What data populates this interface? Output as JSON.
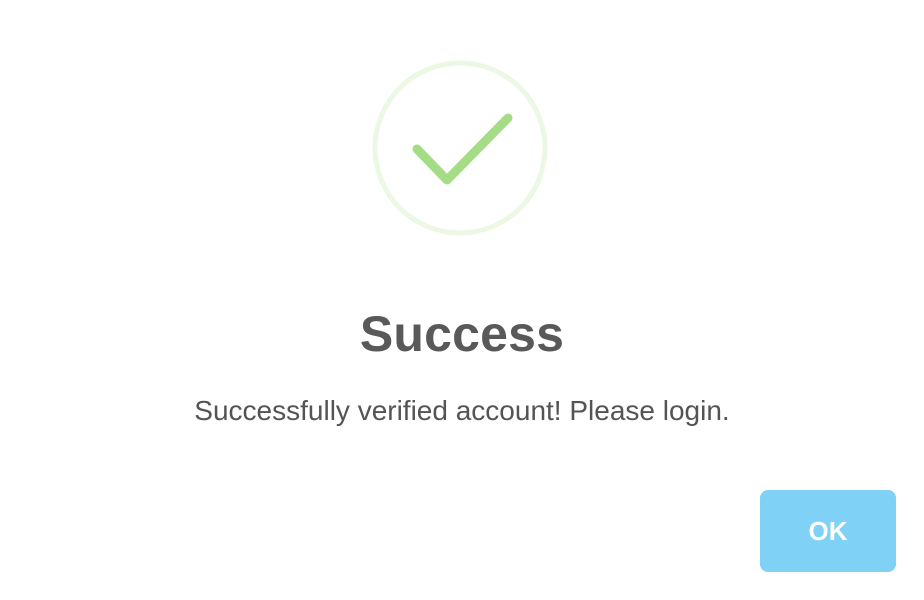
{
  "dialog": {
    "icon": "success-check-icon",
    "title": "Success",
    "message": "Successfully verified account! Please login.",
    "confirm_label": "OK"
  },
  "colors": {
    "check": "#a5dc86",
    "ring": "#ecf8e4",
    "title": "#595959",
    "message": "#545454",
    "button_bg": "#7fd1f6",
    "button_text": "#ffffff"
  }
}
